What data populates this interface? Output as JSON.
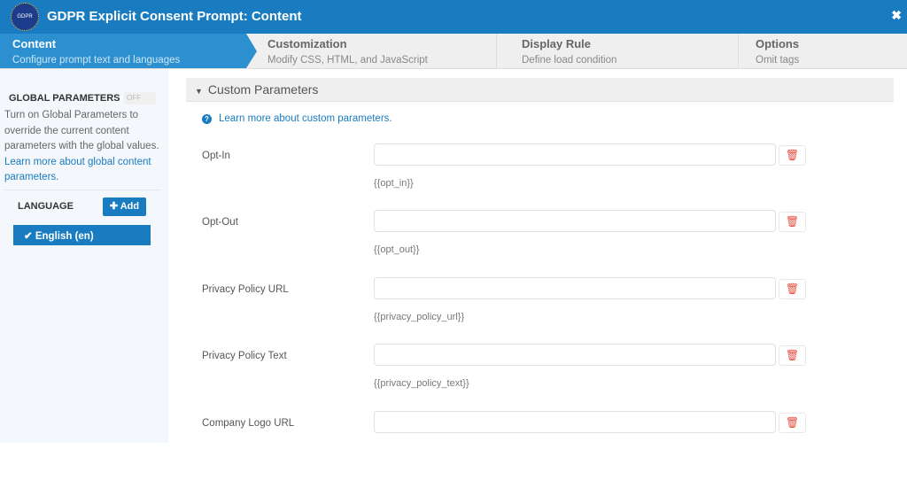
{
  "header": {
    "logo_text": "GDPR",
    "title": "GDPR Explicit Consent Prompt: Content",
    "close": "✖"
  },
  "tabs": [
    {
      "title": "Content",
      "subtitle": "Configure prompt text and languages"
    },
    {
      "title": "Customization",
      "subtitle": "Modify CSS, HTML, and JavaScript"
    },
    {
      "title": "Display Rule",
      "subtitle": "Define load condition"
    },
    {
      "title": "Options",
      "subtitle": "Omit tags"
    }
  ],
  "sidebar": {
    "global_title": "GLOBAL PARAMETERS",
    "toggle": "OFF",
    "desc": "Turn on Global Parameters to override the current content parameters with the global values.",
    "link": "Learn more about global content parameters.",
    "language_label": "LANGUAGE",
    "add": "Add",
    "language": "English (en)"
  },
  "main": {
    "section": "Custom Parameters",
    "help": "Learn more about custom parameters.",
    "params": [
      {
        "label": "Opt-In",
        "value": "",
        "token": "{{opt_in}}"
      },
      {
        "label": "Opt-Out",
        "value": "",
        "token": "{{opt_out}}"
      },
      {
        "label": "Privacy Policy URL",
        "value": "",
        "token": "{{privacy_policy_url}}"
      },
      {
        "label": "Privacy Policy Text",
        "value": "",
        "token": "{{privacy_policy_text}}"
      },
      {
        "label": "Company Logo URL",
        "value": "",
        "token": ""
      }
    ]
  }
}
